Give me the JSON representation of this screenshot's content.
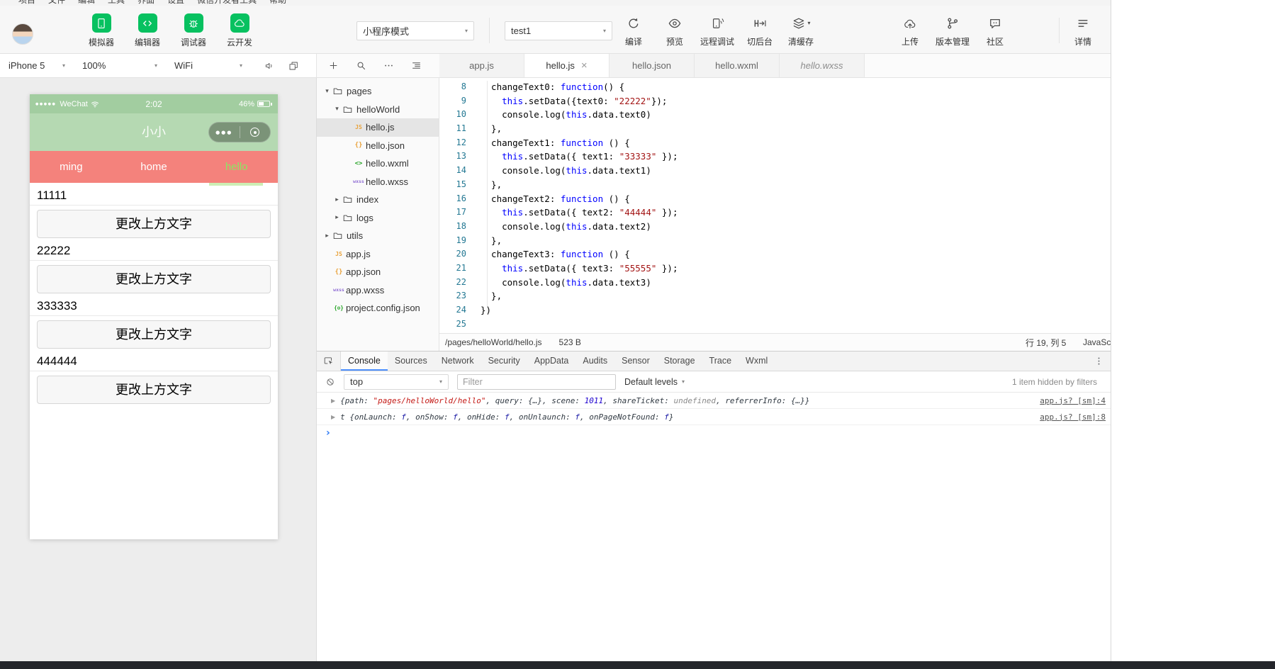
{
  "menubar": {
    "items": [
      "项目",
      "文件",
      "编辑",
      "工具",
      "界面",
      "设置",
      "微信开发者工具",
      "帮助"
    ]
  },
  "toolbar": {
    "workspace_buttons": [
      {
        "label": "模拟器",
        "icon": "simulator-icon"
      },
      {
        "label": "编辑器",
        "icon": "editor-icon"
      },
      {
        "label": "调试器",
        "icon": "debugger-icon"
      },
      {
        "label": "云开发",
        "icon": "cloud-dev-icon"
      }
    ],
    "mode_select": {
      "value": "小程序模式"
    },
    "project_select": {
      "value": "test1"
    },
    "action_buttons": [
      {
        "label": "编译",
        "icon": "compile-icon"
      },
      {
        "label": "预览",
        "icon": "preview-icon"
      },
      {
        "label": "远程调试",
        "icon": "remote-debug-icon"
      },
      {
        "label": "切后台",
        "icon": "switch-background-icon"
      },
      {
        "label": "清缓存",
        "icon": "clear-cache-icon",
        "dropdown": true
      }
    ],
    "right_buttons": [
      {
        "label": "上传",
        "icon": "upload-icon"
      },
      {
        "label": "版本管理",
        "icon": "version-control-icon"
      },
      {
        "label": "社区",
        "icon": "community-icon"
      }
    ],
    "details_button": {
      "label": "详情",
      "icon": "details-icon"
    }
  },
  "simulator_bar": {
    "device": "iPhone 5",
    "zoom": "100%",
    "network": "WiFi"
  },
  "phone": {
    "status": {
      "signal": "●●●●●",
      "carrier": "WeChat",
      "time": "2:02",
      "battery": "46%"
    },
    "nav_title": "小小",
    "tabs": [
      {
        "label": "ming",
        "active": false
      },
      {
        "label": "home",
        "active": false
      },
      {
        "label": "hello",
        "active": true
      }
    ],
    "groups": [
      {
        "value": "11111",
        "button": "更改上方文字"
      },
      {
        "value": "22222",
        "button": "更改上方文字"
      },
      {
        "value": "333333",
        "button": "更改上方文字"
      },
      {
        "value": "444444",
        "button": "更改上方文字"
      }
    ]
  },
  "explorer": {
    "items": [
      {
        "label": "pages",
        "type": "folder",
        "level": 0,
        "expanded": true
      },
      {
        "label": "helloWorld",
        "type": "folder",
        "level": 1,
        "expanded": true
      },
      {
        "label": "hello.js",
        "type": "js",
        "level": 2,
        "selected": true
      },
      {
        "label": "hello.json",
        "type": "json",
        "level": 2
      },
      {
        "label": "hello.wxml",
        "type": "wxml",
        "level": 2
      },
      {
        "label": "hello.wxss",
        "type": "wxss",
        "level": 2
      },
      {
        "label": "index",
        "type": "folder",
        "level": 1,
        "expanded": false
      },
      {
        "label": "logs",
        "type": "folder",
        "level": 1,
        "expanded": false
      },
      {
        "label": "utils",
        "type": "folder",
        "level": 0,
        "expanded": false
      },
      {
        "label": "app.js",
        "type": "js",
        "level": 0
      },
      {
        "label": "app.json",
        "type": "json",
        "level": 0
      },
      {
        "label": "app.wxss",
        "type": "wxss",
        "level": 0
      },
      {
        "label": "project.config.json",
        "type": "config",
        "level": 0
      }
    ]
  },
  "editor": {
    "tabs": [
      {
        "label": "app.js",
        "active": false
      },
      {
        "label": "hello.js",
        "active": true,
        "closable": true
      },
      {
        "label": "hello.json",
        "active": false
      },
      {
        "label": "hello.wxml",
        "active": false
      },
      {
        "label": "hello.wxss",
        "active": false,
        "preview": true
      }
    ],
    "first_line_number": 8,
    "lines": [
      [
        [
          "p",
          "  changeText0: "
        ],
        [
          "k",
          "function"
        ],
        [
          "p",
          "() {"
        ]
      ],
      [
        [
          "p",
          "    "
        ],
        [
          "k",
          "this"
        ],
        [
          "p",
          ".setData({text0: "
        ],
        [
          "s",
          "\"22222\""
        ],
        [
          "p",
          "});"
        ]
      ],
      [
        [
          "p",
          "    console.log("
        ],
        [
          "k",
          "this"
        ],
        [
          "p",
          ".data.text0)"
        ]
      ],
      [
        [
          "p",
          "  },"
        ]
      ],
      [
        [
          "p",
          "  changeText1: "
        ],
        [
          "k",
          "function"
        ],
        [
          "p",
          " () {"
        ]
      ],
      [
        [
          "p",
          "    "
        ],
        [
          "k",
          "this"
        ],
        [
          "p",
          ".setData({ text1: "
        ],
        [
          "s",
          "\"33333\""
        ],
        [
          "p",
          " });"
        ]
      ],
      [
        [
          "p",
          "    console.log("
        ],
        [
          "k",
          "this"
        ],
        [
          "p",
          ".data.text1)"
        ]
      ],
      [
        [
          "p",
          "  },"
        ]
      ],
      [
        [
          "p",
          "  changeText2: "
        ],
        [
          "k",
          "function"
        ],
        [
          "p",
          " () {"
        ]
      ],
      [
        [
          "p",
          "    "
        ],
        [
          "k",
          "this"
        ],
        [
          "p",
          ".setData({ text2: "
        ],
        [
          "s",
          "\"44444\""
        ],
        [
          "p",
          " });"
        ]
      ],
      [
        [
          "p",
          "    console.log("
        ],
        [
          "k",
          "this"
        ],
        [
          "p",
          ".data.text2)"
        ]
      ],
      [
        [
          "p",
          "  },"
        ]
      ],
      [
        [
          "p",
          "  changeText3: "
        ],
        [
          "k",
          "function"
        ],
        [
          "p",
          " () {"
        ]
      ],
      [
        [
          "p",
          "    "
        ],
        [
          "k",
          "this"
        ],
        [
          "p",
          ".setData({ text3: "
        ],
        [
          "s",
          "\"55555\""
        ],
        [
          "p",
          " });"
        ]
      ],
      [
        [
          "p",
          "    console.log("
        ],
        [
          "k",
          "this"
        ],
        [
          "p",
          ".data.text3)"
        ]
      ],
      [
        [
          "p",
          "  },"
        ]
      ],
      [
        [
          "p",
          "})"
        ]
      ],
      []
    ],
    "status": {
      "path": "/pages/helloWorld/hello.js",
      "size": "523 B",
      "cursor": "行 19, 列 5",
      "language": "JavaScript"
    }
  },
  "devtools": {
    "tabs": [
      {
        "label": "Console",
        "active": true
      },
      {
        "label": "Sources",
        "active": false
      },
      {
        "label": "Network",
        "active": false
      },
      {
        "label": "Security",
        "active": false
      },
      {
        "label": "AppData",
        "active": false
      },
      {
        "label": "Audits",
        "active": false
      },
      {
        "label": "Sensor",
        "active": false
      },
      {
        "label": "Storage",
        "active": false
      },
      {
        "label": "Trace",
        "active": false
      },
      {
        "label": "Wxml",
        "active": false
      }
    ],
    "toolbar": {
      "context": "top",
      "filter_placeholder": "Filter",
      "levels": "Default levels",
      "hidden_note": "1 item hidden by filters"
    },
    "entries": [
      {
        "tokens": [
          [
            "plain",
            "{"
          ],
          [
            "key",
            "path"
          ],
          [
            "plain",
            ": "
          ],
          [
            "str",
            "\"pages/helloWorld/hello\""
          ],
          [
            "plain",
            ", "
          ],
          [
            "key",
            "query"
          ],
          [
            "plain",
            ": {…}, "
          ],
          [
            "key",
            "scene"
          ],
          [
            "plain",
            ": "
          ],
          [
            "num",
            "1011"
          ],
          [
            "plain",
            ", "
          ],
          [
            "key",
            "shareTicket"
          ],
          [
            "plain",
            ": "
          ],
          [
            "und",
            "undefined"
          ],
          [
            "plain",
            ", "
          ],
          [
            "key",
            "referrerInfo"
          ],
          [
            "plain",
            ": {…}}"
          ]
        ],
        "source": "app.js? [sm]:4"
      },
      {
        "tokens": [
          [
            "plain",
            "t {"
          ],
          [
            "key",
            "onLaunch"
          ],
          [
            "plain",
            ": "
          ],
          [
            "fn",
            "f"
          ],
          [
            "plain",
            ", "
          ],
          [
            "key",
            "onShow"
          ],
          [
            "plain",
            ": "
          ],
          [
            "fn",
            "f"
          ],
          [
            "plain",
            ", "
          ],
          [
            "key",
            "onHide"
          ],
          [
            "plain",
            ": "
          ],
          [
            "fn",
            "f"
          ],
          [
            "plain",
            ", "
          ],
          [
            "key",
            "onUnlaunch"
          ],
          [
            "plain",
            ": "
          ],
          [
            "fn",
            "f"
          ],
          [
            "plain",
            ", "
          ],
          [
            "key",
            "onPageNotFound"
          ],
          [
            "plain",
            ": "
          ],
          [
            "fn",
            "f"
          ],
          [
            "plain",
            "}"
          ]
        ],
        "source": "app.js? [sm]:8"
      }
    ]
  }
}
